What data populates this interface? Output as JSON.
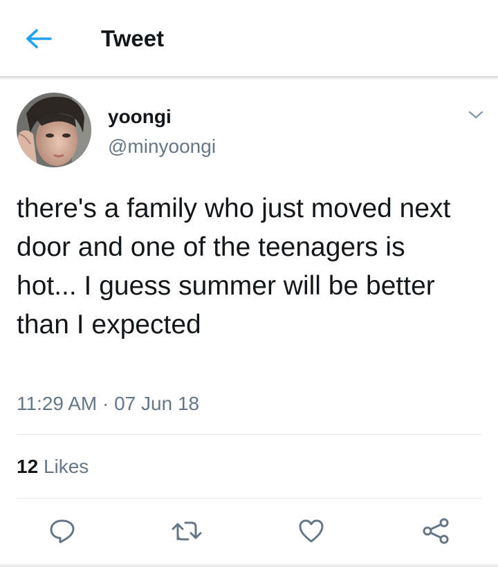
{
  "header": {
    "title": "Tweet",
    "back_icon": "arrow-left-icon",
    "accent_color": "#1da1f2"
  },
  "tweet": {
    "author": {
      "name": "yoongi",
      "handle": "@minyoongi",
      "avatar_icon": "profile-photo"
    },
    "text": "there's a family who just moved next door and one of the teenagers is hot... I guess summer will be better than I expected",
    "timestamp": "11:29 AM · 07 Jun 18",
    "stats": {
      "likes_count": "12",
      "likes_label": "Likes"
    }
  },
  "actions": [
    {
      "name": "reply",
      "icon": "reply-icon"
    },
    {
      "name": "retweet",
      "icon": "retweet-icon"
    },
    {
      "name": "like",
      "icon": "heart-icon"
    },
    {
      "name": "share",
      "icon": "share-icon"
    }
  ],
  "colors": {
    "text_primary": "#14171a",
    "text_secondary": "#657786",
    "divider": "#e1e8ed",
    "accent": "#1da1f2"
  }
}
